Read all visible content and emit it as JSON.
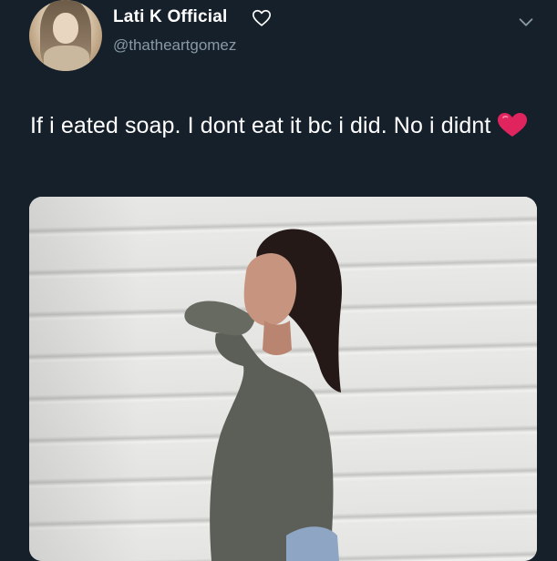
{
  "user": {
    "display_name": "Lati K Official",
    "handle": "@thatheartgomez"
  },
  "tweet": {
    "text": "If i eated soap. I dont eat it bc i did. No i didnt"
  },
  "icons": {
    "name_heart": "heart-outline-icon",
    "menu": "chevron-down-icon",
    "text_emoji": "red-heart-icon"
  },
  "colors": {
    "background": "#15202b",
    "handle": "#8899a6",
    "heart_emoji": "#e0245e"
  }
}
